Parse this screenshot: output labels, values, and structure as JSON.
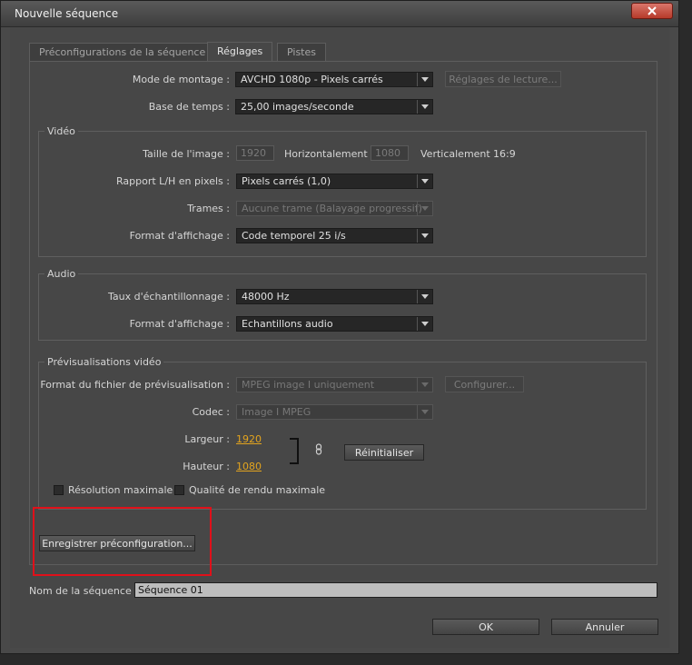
{
  "window": {
    "title": "Nouvelle séquence"
  },
  "tabs": [
    {
      "label": "Préconfigurations de la séquence",
      "active": false
    },
    {
      "label": "Réglages",
      "active": true
    },
    {
      "label": "Pistes",
      "active": false
    }
  ],
  "settings": {
    "edit_mode_label": "Mode de montage :",
    "edit_mode_value": "AVCHD 1080p - Pixels carrés",
    "playback_button": "Réglages de lecture...",
    "timebase_label": "Base de temps :",
    "timebase_value": "25,00 images/seconde"
  },
  "video": {
    "group_title": "Vidéo",
    "frame_size_label": "Taille de l'image :",
    "width_value": "1920",
    "horizontal_label": "Horizontalement",
    "height_value": "1080",
    "vertical_label": "Verticalement",
    "aspect_ratio": "16:9",
    "pixel_aspect_label": "Rapport L/H en pixels :",
    "pixel_aspect_value": "Pixels carrés (1,0)",
    "fields_label": "Trames :",
    "fields_value": "Aucune trame (Balayage progressif)",
    "display_format_label": "Format d'affichage :",
    "display_format_value": "Code temporel 25 i/s"
  },
  "audio": {
    "group_title": "Audio",
    "sample_rate_label": "Taux d'échantillonnage :",
    "sample_rate_value": "48000 Hz",
    "display_format_label": "Format d'affichage :",
    "display_format_value": "Echantillons audio"
  },
  "preview": {
    "group_title": "Prévisualisations vidéo",
    "file_format_label": "Format du fichier de prévisualisation :",
    "file_format_value": "MPEG image I uniquement",
    "configure_button": "Configurer...",
    "codec_label": "Codec :",
    "codec_value": "Image I MPEG",
    "width_label": "Largeur :",
    "width_value": "1920",
    "height_label": "Hauteur :",
    "height_value": "1080",
    "reset_button": "Réinitialiser",
    "max_resolution_label": "Résolution maximale",
    "max_quality_label": "Qualité de rendu maximale"
  },
  "save_preset_button": "Enregistrer préconfiguration...",
  "sequence_name_label": "Nom de la séquence :",
  "sequence_name_value": "Séquence 01",
  "ok_button": "OK",
  "cancel_button": "Annuler",
  "colors": {
    "accent": "#e3a41e",
    "highlight": "#e0101a"
  }
}
